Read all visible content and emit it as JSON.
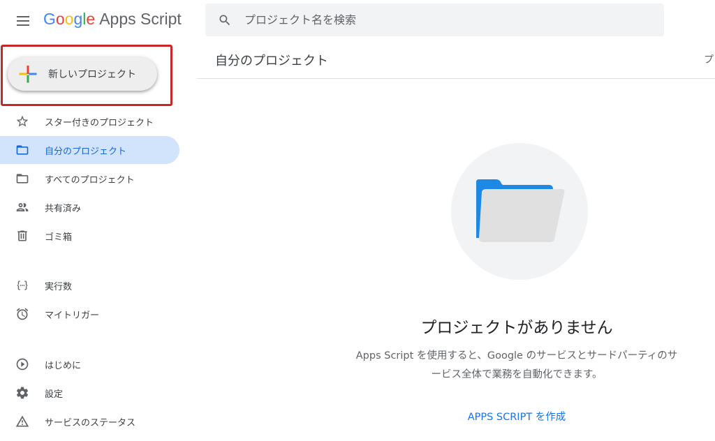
{
  "header": {
    "logo": {
      "letters": [
        "G",
        "o",
        "o",
        "g",
        "l",
        "e"
      ],
      "product": "Apps Script"
    },
    "search_placeholder": "プロジェクト名を検索"
  },
  "new_project": {
    "label": "新しいプロジェクト"
  },
  "sidebar": {
    "items": [
      {
        "label": "スター付きのプロジェクト",
        "icon": "star-icon"
      },
      {
        "label": "自分のプロジェクト",
        "icon": "folder-icon",
        "active": true
      },
      {
        "label": "すべてのプロジェクト",
        "icon": "folder-icon"
      },
      {
        "label": "共有済み",
        "icon": "people-icon"
      },
      {
        "label": "ゴミ箱",
        "icon": "trash-icon"
      },
      {
        "label": "実行数",
        "icon": "executions-icon"
      },
      {
        "label": "マイトリガー",
        "icon": "alarm-icon"
      },
      {
        "label": "はじめに",
        "icon": "play-circle-icon"
      },
      {
        "label": "設定",
        "icon": "gear-icon"
      },
      {
        "label": "サービスのステータス",
        "icon": "warning-icon"
      }
    ]
  },
  "main": {
    "title": "自分のプロジェクト",
    "right_clipped": "プ",
    "empty": {
      "title": "プロジェクトがありません",
      "desc_line1": "Apps Script を使用すると、Google のサービスとサードパーティのサ",
      "desc_line2": "ービス全体で業務を自動化できます。",
      "link": "APPS SCRIPT を作成"
    }
  },
  "colors": {
    "accent": "#1a73e8",
    "active_bg": "#d2e3fc",
    "highlight_border": "#c62828",
    "folder_blue": "#1e88e5",
    "folder_grey": "#e0e0e0"
  }
}
